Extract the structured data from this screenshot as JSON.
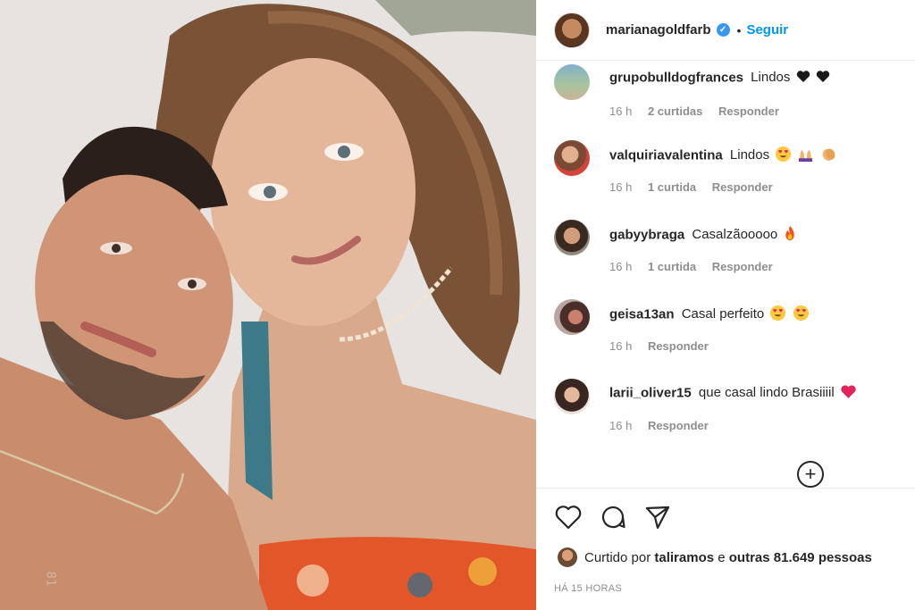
{
  "post": {
    "username": "marianagoldfarb",
    "follow_label": "Seguir",
    "dot": "•",
    "photo_watermark": "81"
  },
  "comments": [
    {
      "user": "grupobulldogfrances",
      "text": "Lindos",
      "emojis": [
        "black-heart",
        "black-heart"
      ],
      "time": "16 h",
      "likes": "2 curtidas",
      "reply": "Responder"
    },
    {
      "user": "valquiriavalentina",
      "text": "Lindos",
      "emojis": [
        "heart-eyes",
        "raised-hands",
        "clap"
      ],
      "time": "16 h",
      "likes": "1 curtida",
      "reply": "Responder"
    },
    {
      "user": "gabyybraga",
      "text": "Casalzãooooo",
      "emojis": [
        "fire"
      ],
      "time": "16 h",
      "likes": "1 curtida",
      "reply": "Responder"
    },
    {
      "user": "geisa13an",
      "text": "Casal perfeito",
      "emojis": [
        "heart-eyes",
        "heart-eyes"
      ],
      "time": "16 h",
      "likes": "",
      "reply": "Responder"
    },
    {
      "user": "larii_oliver15",
      "text": "que casal lindo Brasiiiil",
      "emojis": [
        "red-heart"
      ],
      "time": "16 h",
      "likes": "",
      "reply": "Responder"
    }
  ],
  "likes": {
    "prefix": "Curtido por",
    "user": "taliramos",
    "joiner": "e",
    "others": "outras 81.649 pessoas"
  },
  "timestamp": "HÁ 15 HORAS",
  "icons": [
    "heart-icon",
    "comment-icon",
    "share-icon",
    "add-comment-icon",
    "verified-icon"
  ],
  "colors": {
    "accent": "#0095f6",
    "verified": "#3897f0",
    "text": "#262626",
    "muted": "#8e8e8e"
  }
}
